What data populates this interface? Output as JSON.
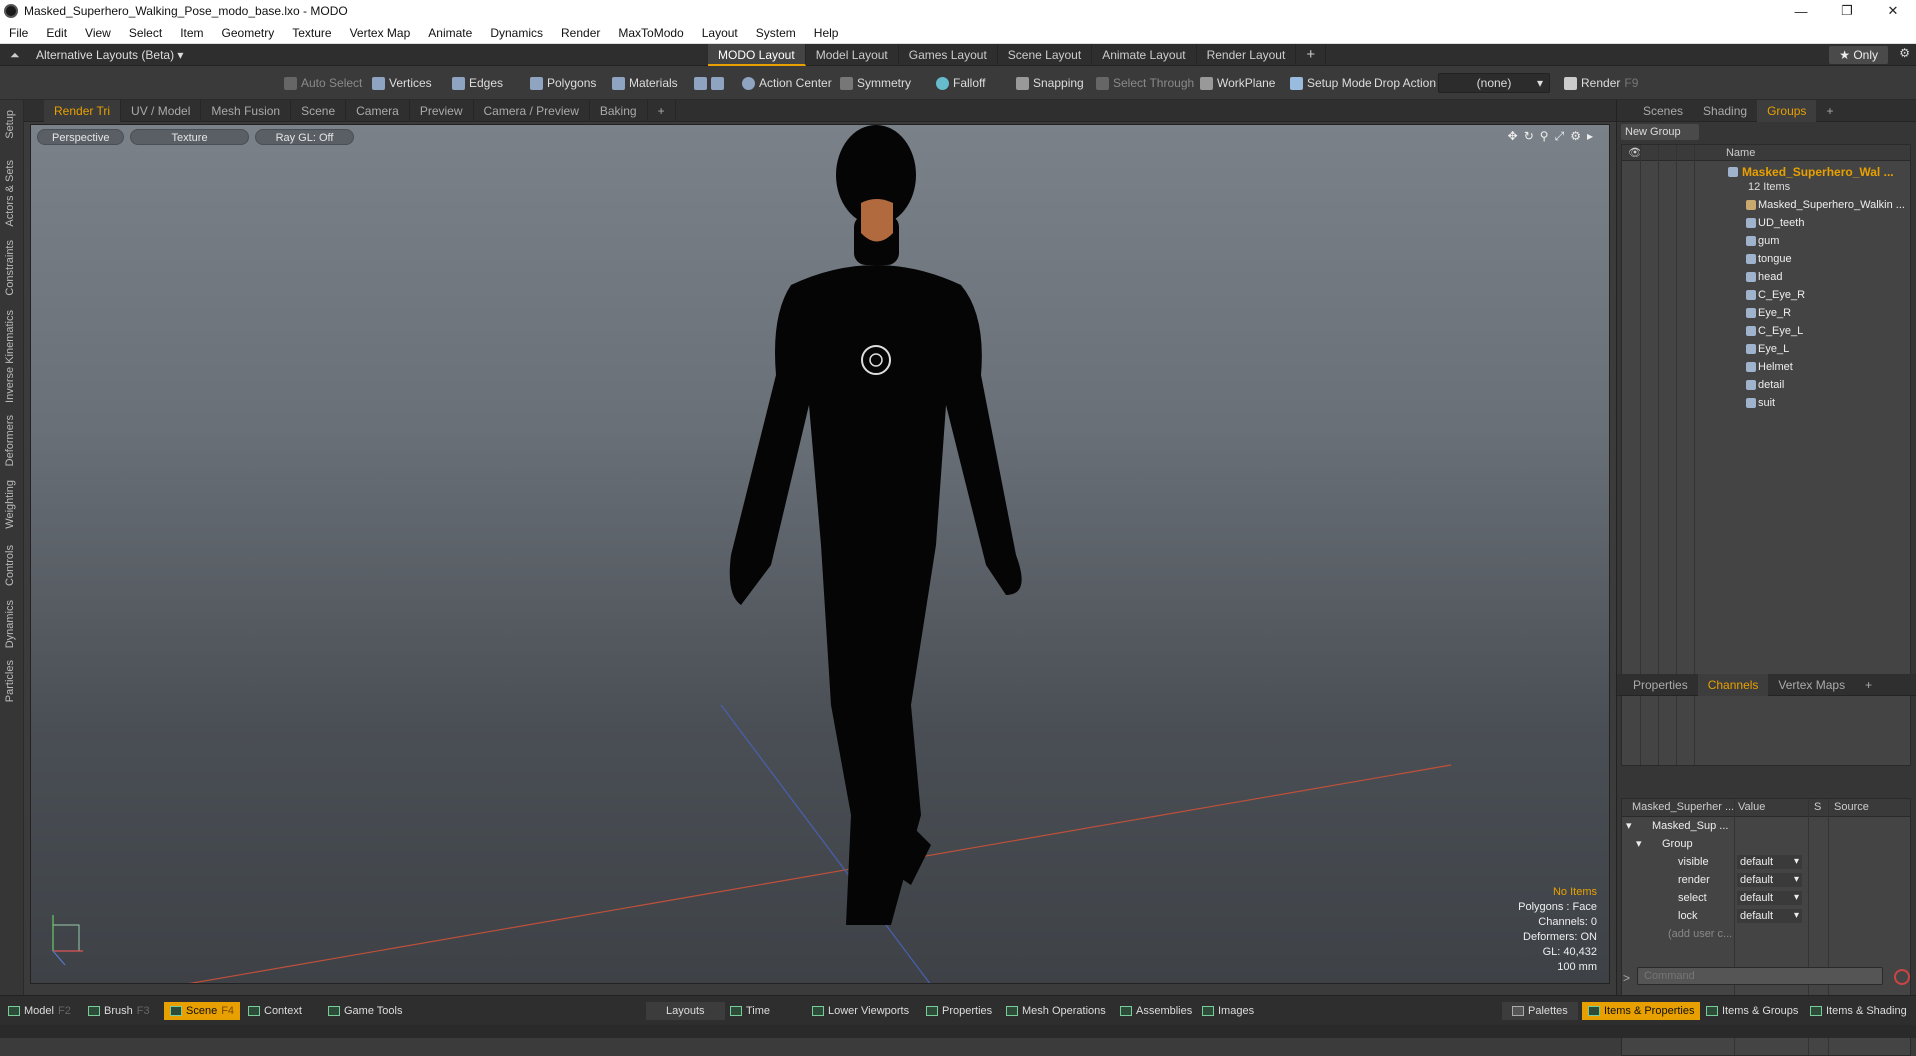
{
  "window": {
    "title": "Masked_Superhero_Walking_Pose_modo_base.lxo - MODO",
    "minimize": "—",
    "restore": "❐",
    "close": "✕"
  },
  "menu": [
    "File",
    "Edit",
    "View",
    "Select",
    "Item",
    "Geometry",
    "Texture",
    "Vertex Map",
    "Animate",
    "Dynamics",
    "Render",
    "MaxToModo",
    "Layout",
    "System",
    "Help"
  ],
  "layoutbar": {
    "alt": "Alternative Layouts (Beta) ▾",
    "tabs": [
      "MODO Layout",
      "Model Layout",
      "Games Layout",
      "Scene Layout",
      "Animate Layout",
      "Render Layout"
    ],
    "add": "+",
    "only": "★ Only",
    "gear": "⚙"
  },
  "toolbar": {
    "auto_select": "Auto Select",
    "vertices": "Vertices",
    "edges": "Edges",
    "polygons": "Polygons",
    "materials": "Materials",
    "action_center": "Action Center",
    "symmetry": "Symmetry",
    "falloff": "Falloff",
    "snapping": "Snapping",
    "select_through": "Select Through",
    "workplane": "WorkPlane",
    "setup_mode": "Setup Mode",
    "drop_action": "Drop Action",
    "drop_value": "(none)",
    "render": "Render",
    "render_key": "F9"
  },
  "lefttabs": [
    "Setup",
    "Actors & Sets",
    "Constraints",
    "Inverse Kinematics",
    "Deformers",
    "Weighting",
    "Controls",
    "Dynamics",
    "Particles"
  ],
  "vptabs": [
    "Render Tri",
    "UV / Model",
    "Mesh Fusion",
    "Scene",
    "Camera",
    "Preview",
    "Camera / Preview",
    "Baking",
    "+"
  ],
  "viewport": {
    "perspective": "Perspective",
    "texture": "Texture",
    "raygl": "Ray GL: Off",
    "stats": [
      "No Items",
      "Polygons : Face",
      "Channels: 0",
      "Deformers: ON",
      "GL: 40,432",
      "100 mm"
    ]
  },
  "right": {
    "tabs_top": [
      "Scenes",
      "Shading",
      "Groups",
      "+"
    ],
    "new_group": "New Group",
    "name_col": "Name",
    "group_name": "Masked_Superhero_Wal ...",
    "item_count": "12 Items",
    "items": [
      "Masked_Superhero_Walkin ...",
      "UD_teeth",
      "gum",
      "tongue",
      "head",
      "C_Eye_R",
      "Eye_R",
      "C_Eye_L",
      "Eye_L",
      "Helmet",
      "detail",
      "suit"
    ],
    "tabs_bottom": [
      "Properties",
      "Channels",
      "Vertex Maps",
      "+"
    ],
    "ch_cols": [
      "Masked_Superher ...",
      "Value",
      "S",
      "Source"
    ],
    "ch_item": "Masked_Sup ...",
    "ch_group": "Group",
    "channels": [
      {
        "name": "visible",
        "value": "default"
      },
      {
        "name": "render",
        "value": "default"
      },
      {
        "name": "select",
        "value": "default"
      },
      {
        "name": "lock",
        "value": "default"
      }
    ],
    "add_user": "(add user c...",
    "command": "Command"
  },
  "bottom": {
    "model": "Model",
    "model_key": "F2",
    "brush": "Brush",
    "brush_key": "F3",
    "scene": "Scene",
    "scene_key": "F4",
    "context": "Context",
    "game_tools": "Game Tools",
    "layouts": "Layouts",
    "time": "Time",
    "lower_viewports": "Lower Viewports",
    "properties": "Properties",
    "mesh_operations": "Mesh Operations",
    "assemblies": "Assemblies",
    "images": "Images",
    "palettes": "Palettes",
    "items_properties": "Items & Properties",
    "items_groups": "Items & Groups",
    "items_shading": "Items & Shading"
  }
}
